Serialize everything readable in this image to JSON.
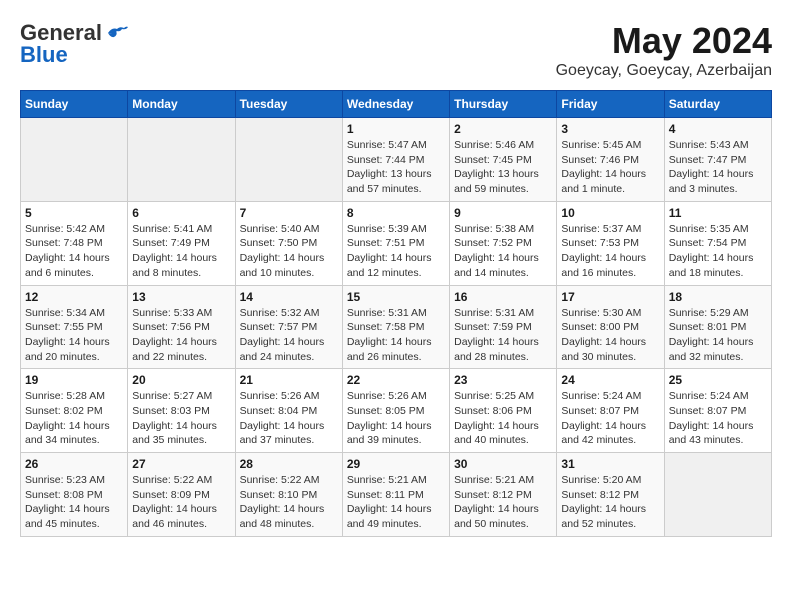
{
  "header": {
    "logo_general": "General",
    "logo_blue": "Blue",
    "month_year": "May 2024",
    "location": "Goeycay, Goeycay, Azerbaijan"
  },
  "days_of_week": [
    "Sunday",
    "Monday",
    "Tuesday",
    "Wednesday",
    "Thursday",
    "Friday",
    "Saturday"
  ],
  "weeks": [
    [
      {
        "day": "",
        "info": ""
      },
      {
        "day": "",
        "info": ""
      },
      {
        "day": "",
        "info": ""
      },
      {
        "day": "1",
        "info": "Sunrise: 5:47 AM\nSunset: 7:44 PM\nDaylight: 13 hours\nand 57 minutes."
      },
      {
        "day": "2",
        "info": "Sunrise: 5:46 AM\nSunset: 7:45 PM\nDaylight: 13 hours\nand 59 minutes."
      },
      {
        "day": "3",
        "info": "Sunrise: 5:45 AM\nSunset: 7:46 PM\nDaylight: 14 hours\nand 1 minute."
      },
      {
        "day": "4",
        "info": "Sunrise: 5:43 AM\nSunset: 7:47 PM\nDaylight: 14 hours\nand 3 minutes."
      }
    ],
    [
      {
        "day": "5",
        "info": "Sunrise: 5:42 AM\nSunset: 7:48 PM\nDaylight: 14 hours\nand 6 minutes."
      },
      {
        "day": "6",
        "info": "Sunrise: 5:41 AM\nSunset: 7:49 PM\nDaylight: 14 hours\nand 8 minutes."
      },
      {
        "day": "7",
        "info": "Sunrise: 5:40 AM\nSunset: 7:50 PM\nDaylight: 14 hours\nand 10 minutes."
      },
      {
        "day": "8",
        "info": "Sunrise: 5:39 AM\nSunset: 7:51 PM\nDaylight: 14 hours\nand 12 minutes."
      },
      {
        "day": "9",
        "info": "Sunrise: 5:38 AM\nSunset: 7:52 PM\nDaylight: 14 hours\nand 14 minutes."
      },
      {
        "day": "10",
        "info": "Sunrise: 5:37 AM\nSunset: 7:53 PM\nDaylight: 14 hours\nand 16 minutes."
      },
      {
        "day": "11",
        "info": "Sunrise: 5:35 AM\nSunset: 7:54 PM\nDaylight: 14 hours\nand 18 minutes."
      }
    ],
    [
      {
        "day": "12",
        "info": "Sunrise: 5:34 AM\nSunset: 7:55 PM\nDaylight: 14 hours\nand 20 minutes."
      },
      {
        "day": "13",
        "info": "Sunrise: 5:33 AM\nSunset: 7:56 PM\nDaylight: 14 hours\nand 22 minutes."
      },
      {
        "day": "14",
        "info": "Sunrise: 5:32 AM\nSunset: 7:57 PM\nDaylight: 14 hours\nand 24 minutes."
      },
      {
        "day": "15",
        "info": "Sunrise: 5:31 AM\nSunset: 7:58 PM\nDaylight: 14 hours\nand 26 minutes."
      },
      {
        "day": "16",
        "info": "Sunrise: 5:31 AM\nSunset: 7:59 PM\nDaylight: 14 hours\nand 28 minutes."
      },
      {
        "day": "17",
        "info": "Sunrise: 5:30 AM\nSunset: 8:00 PM\nDaylight: 14 hours\nand 30 minutes."
      },
      {
        "day": "18",
        "info": "Sunrise: 5:29 AM\nSunset: 8:01 PM\nDaylight: 14 hours\nand 32 minutes."
      }
    ],
    [
      {
        "day": "19",
        "info": "Sunrise: 5:28 AM\nSunset: 8:02 PM\nDaylight: 14 hours\nand 34 minutes."
      },
      {
        "day": "20",
        "info": "Sunrise: 5:27 AM\nSunset: 8:03 PM\nDaylight: 14 hours\nand 35 minutes."
      },
      {
        "day": "21",
        "info": "Sunrise: 5:26 AM\nSunset: 8:04 PM\nDaylight: 14 hours\nand 37 minutes."
      },
      {
        "day": "22",
        "info": "Sunrise: 5:26 AM\nSunset: 8:05 PM\nDaylight: 14 hours\nand 39 minutes."
      },
      {
        "day": "23",
        "info": "Sunrise: 5:25 AM\nSunset: 8:06 PM\nDaylight: 14 hours\nand 40 minutes."
      },
      {
        "day": "24",
        "info": "Sunrise: 5:24 AM\nSunset: 8:07 PM\nDaylight: 14 hours\nand 42 minutes."
      },
      {
        "day": "25",
        "info": "Sunrise: 5:24 AM\nSunset: 8:07 PM\nDaylight: 14 hours\nand 43 minutes."
      }
    ],
    [
      {
        "day": "26",
        "info": "Sunrise: 5:23 AM\nSunset: 8:08 PM\nDaylight: 14 hours\nand 45 minutes."
      },
      {
        "day": "27",
        "info": "Sunrise: 5:22 AM\nSunset: 8:09 PM\nDaylight: 14 hours\nand 46 minutes."
      },
      {
        "day": "28",
        "info": "Sunrise: 5:22 AM\nSunset: 8:10 PM\nDaylight: 14 hours\nand 48 minutes."
      },
      {
        "day": "29",
        "info": "Sunrise: 5:21 AM\nSunset: 8:11 PM\nDaylight: 14 hours\nand 49 minutes."
      },
      {
        "day": "30",
        "info": "Sunrise: 5:21 AM\nSunset: 8:12 PM\nDaylight: 14 hours\nand 50 minutes."
      },
      {
        "day": "31",
        "info": "Sunrise: 5:20 AM\nSunset: 8:12 PM\nDaylight: 14 hours\nand 52 minutes."
      },
      {
        "day": "",
        "info": ""
      }
    ]
  ]
}
